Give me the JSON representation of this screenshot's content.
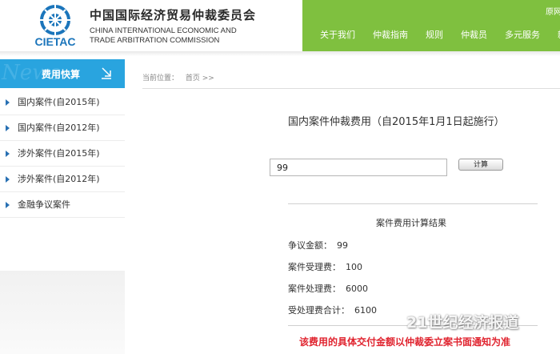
{
  "header": {
    "logo_text": "CIETAC",
    "org_name_cn": "中国国际经济贸易仲裁委员会",
    "org_name_en_line1": "CHINA INTERNATIONAL ECONOMIC AND",
    "org_name_en_line2": "TRADE ARBITRATION COMMISSION",
    "top_link": "原网",
    "nav": [
      "关于我们",
      "仲裁指南",
      "规则",
      "仲裁员",
      "多元服务",
      "新闻"
    ],
    "brand_green": "#7fc03f"
  },
  "sidebar": {
    "bg_word": "News",
    "title": "费用快算",
    "accent": "#29a4df",
    "items": [
      {
        "label": "国内案件(自2015年)"
      },
      {
        "label": "国内案件(自2012年)"
      },
      {
        "label": "涉外案件(自2015年)"
      },
      {
        "label": "涉外案件(自2012年)"
      },
      {
        "label": "金融争议案件"
      }
    ]
  },
  "breadcrumb": {
    "label": "当前位置：",
    "home": "首页 >>"
  },
  "main": {
    "title": "国内案件仲裁费用（自2015年1月1日起施行）",
    "amount_value": "99",
    "calc_button": "计算",
    "result_title": "案件费用计算结果",
    "results": [
      {
        "label": "争议金额：",
        "value": "99"
      },
      {
        "label": "案件受理费：",
        "value": "100"
      },
      {
        "label": "案件处理费：",
        "value": "6000"
      },
      {
        "label": "受处理费合计：",
        "value": "6100"
      }
    ],
    "notice": "该费用的具体交付金额以仲裁委立案书面通知为准",
    "notice_color": "#e0242f"
  },
  "watermark": "21世纪经济报道"
}
